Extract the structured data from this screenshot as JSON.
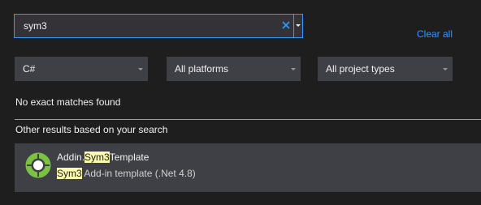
{
  "search": {
    "value": "sym3",
    "clear_icon": "close-icon",
    "dropdown_icon": "chevron-down-icon"
  },
  "clear_all_label": "Clear all",
  "filters": {
    "language": "C#",
    "platform": "All platforms",
    "project_type": "All project types"
  },
  "messages": {
    "no_matches": "No exact matches found",
    "other_results": "Other results based on your search"
  },
  "results": [
    {
      "title_prefix": "Addin.",
      "title_match": "Sym3",
      "title_suffix": "Template",
      "desc_match": "Sym3",
      "desc_suffix": " Add-in template (.Net 4.8)",
      "icon": "template-ring-icon"
    }
  ],
  "colors": {
    "background": "#1e1e1e",
    "accent": "#3399ff",
    "link": "#3794ff",
    "highlight": "#fdfbac",
    "panel": "#3f3f46",
    "icon_green": "#7cc242"
  }
}
